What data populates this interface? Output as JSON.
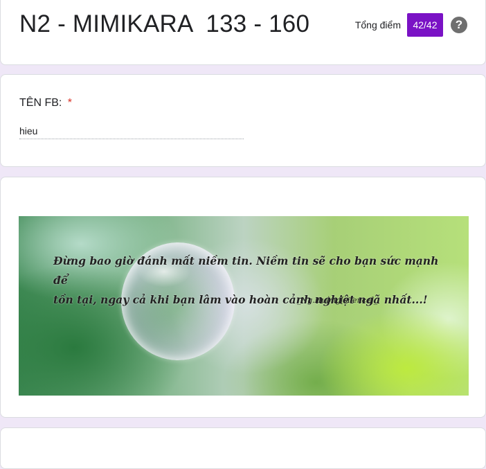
{
  "header": {
    "title": "N2 - MIMIKARA  133 - 160",
    "score_label": "Tổng điểm",
    "score_value": "42/42",
    "help_icon": "help-circle-icon",
    "accent_color": "#7a12c5"
  },
  "question": {
    "label": "TÊN FB:",
    "required_mark": "*",
    "answer": "hieu"
  },
  "banner": {
    "quote_line1": "Đừng bao giờ đánh mất niềm tin. Niềm tin sẽ cho bạn sức mạnh để",
    "quote_line2": "tồn tại, ngay cả khi bạn lâm vào hoàn cảnh nghiệt ngã nhất...!",
    "signature": "_Ng.Hường[silence]_"
  }
}
